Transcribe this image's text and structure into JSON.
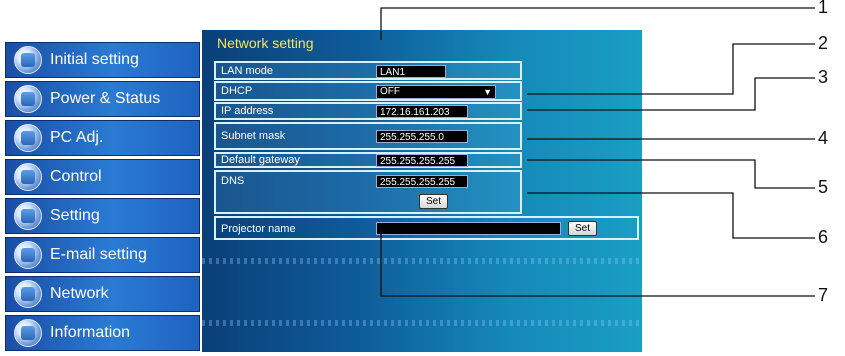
{
  "nav": {
    "items": [
      {
        "label": "Initial setting",
        "icon": "initial-setting-icon"
      },
      {
        "label": "Power & Status",
        "icon": "power-status-icon"
      },
      {
        "label": "PC Adj.",
        "icon": "pc-adjust-icon"
      },
      {
        "label": "Control",
        "icon": "control-icon"
      },
      {
        "label": "Setting",
        "icon": "setting-icon"
      },
      {
        "label": "E-mail setting",
        "icon": "email-icon"
      },
      {
        "label": "Network",
        "icon": "network-icon"
      },
      {
        "label": "Information",
        "icon": "information-icon"
      }
    ]
  },
  "panel": {
    "title": "Network setting",
    "lan_mode": {
      "label": "LAN mode",
      "value": "LAN1"
    },
    "dhcp": {
      "label": "DHCP",
      "value": "OFF"
    },
    "ip_address": {
      "label": "IP address",
      "value": "172.16.161.203"
    },
    "subnet_mask": {
      "label": "Subnet mask",
      "value": "255.255.255.0"
    },
    "default_gateway": {
      "label": "Default gateway",
      "value": "255.255.255.255"
    },
    "dns": {
      "label": "DNS",
      "value": "255.255.255.255",
      "set_label": "Set"
    },
    "projector_name": {
      "label": "Projector name",
      "value": "",
      "set_label": "Set"
    }
  },
  "callouts": [
    "1",
    "2",
    "3",
    "4",
    "5",
    "6",
    "7"
  ],
  "colors": {
    "panel_title": "#f4e65a",
    "nav_blue": "#2a7bd3",
    "field_bg": "#000000"
  }
}
